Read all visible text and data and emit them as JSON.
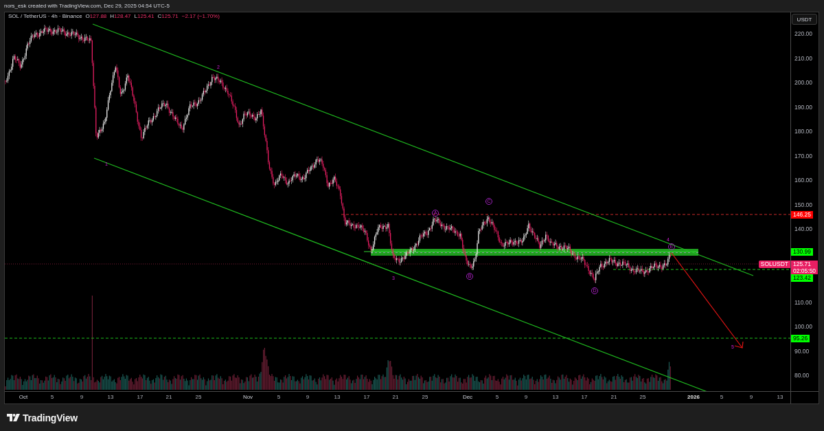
{
  "header": {
    "text": "nors_esk created with TradingView.com, Dec 29, 2025 04:54 UTC-5"
  },
  "legend": {
    "title": "SOL / TetherUS · 4h · Binance",
    "negative": true,
    "values": [
      {
        "label": "O",
        "value": "127.88"
      },
      {
        "label": "H",
        "value": "128.47"
      },
      {
        "label": "L",
        "value": "125.41"
      },
      {
        "label": "C",
        "value": "125.71"
      }
    ],
    "change": "−2.17 (−1.70%)"
  },
  "wave_labels": [
    {
      "text": "1",
      "kind": "number"
    },
    {
      "text": "2",
      "kind": "number"
    },
    {
      "text": "3",
      "kind": "number"
    },
    {
      "text": "A",
      "kind": "circled"
    },
    {
      "text": "B",
      "kind": "circled"
    },
    {
      "text": "C",
      "kind": "circled"
    },
    {
      "text": "D",
      "kind": "circled"
    },
    {
      "text": "4",
      "kind": "number"
    },
    {
      "text": "E",
      "kind": "circled"
    },
    {
      "text": "5",
      "kind": "number"
    }
  ],
  "price_axis": {
    "unit_button": "USDT",
    "ticks": [
      "220.00",
      "210.00",
      "200.00",
      "190.00",
      "180.00",
      "170.00",
      "160.00",
      "150.00",
      "140.00",
      "110.00",
      "100.00",
      "90.00",
      "80.00"
    ]
  },
  "price_tags": [
    {
      "kind": "level",
      "text": "146.25",
      "color": "#ff0000"
    },
    {
      "kind": "level",
      "text": "130.99",
      "color": "#00ff00"
    },
    {
      "kind": "last",
      "symbol": "SOLUSDT",
      "text": "125.71",
      "countdown": "02:05:50",
      "color": "#e91e63"
    },
    {
      "kind": "level",
      "text": "123.42",
      "color": "#00ff00"
    },
    {
      "kind": "level",
      "text": "95.26",
      "color": "#00ff00"
    }
  ],
  "time_axis": {
    "ticks": [
      {
        "text": "Oct",
        "kind": "month"
      },
      {
        "text": "5",
        "kind": "day"
      },
      {
        "text": "9",
        "kind": "day"
      },
      {
        "text": "13",
        "kind": "day"
      },
      {
        "text": "17",
        "kind": "day"
      },
      {
        "text": "21",
        "kind": "day"
      },
      {
        "text": "25",
        "kind": "day"
      },
      {
        "text": "Nov",
        "kind": "month"
      },
      {
        "text": "5",
        "kind": "day"
      },
      {
        "text": "9",
        "kind": "day"
      },
      {
        "text": "13",
        "kind": "day"
      },
      {
        "text": "17",
        "kind": "day"
      },
      {
        "text": "21",
        "kind": "day"
      },
      {
        "text": "25",
        "kind": "day"
      },
      {
        "text": "Dec",
        "kind": "month"
      },
      {
        "text": "5",
        "kind": "day"
      },
      {
        "text": "9",
        "kind": "day"
      },
      {
        "text": "13",
        "kind": "day"
      },
      {
        "text": "17",
        "kind": "day"
      },
      {
        "text": "21",
        "kind": "day"
      },
      {
        "text": "25",
        "kind": "day"
      },
      {
        "text": "2026",
        "kind": "year"
      },
      {
        "text": "5",
        "kind": "day"
      },
      {
        "text": "9",
        "kind": "day"
      },
      {
        "text": "13",
        "kind": "day"
      }
    ]
  },
  "footer": {
    "brand": "TradingView"
  }
}
